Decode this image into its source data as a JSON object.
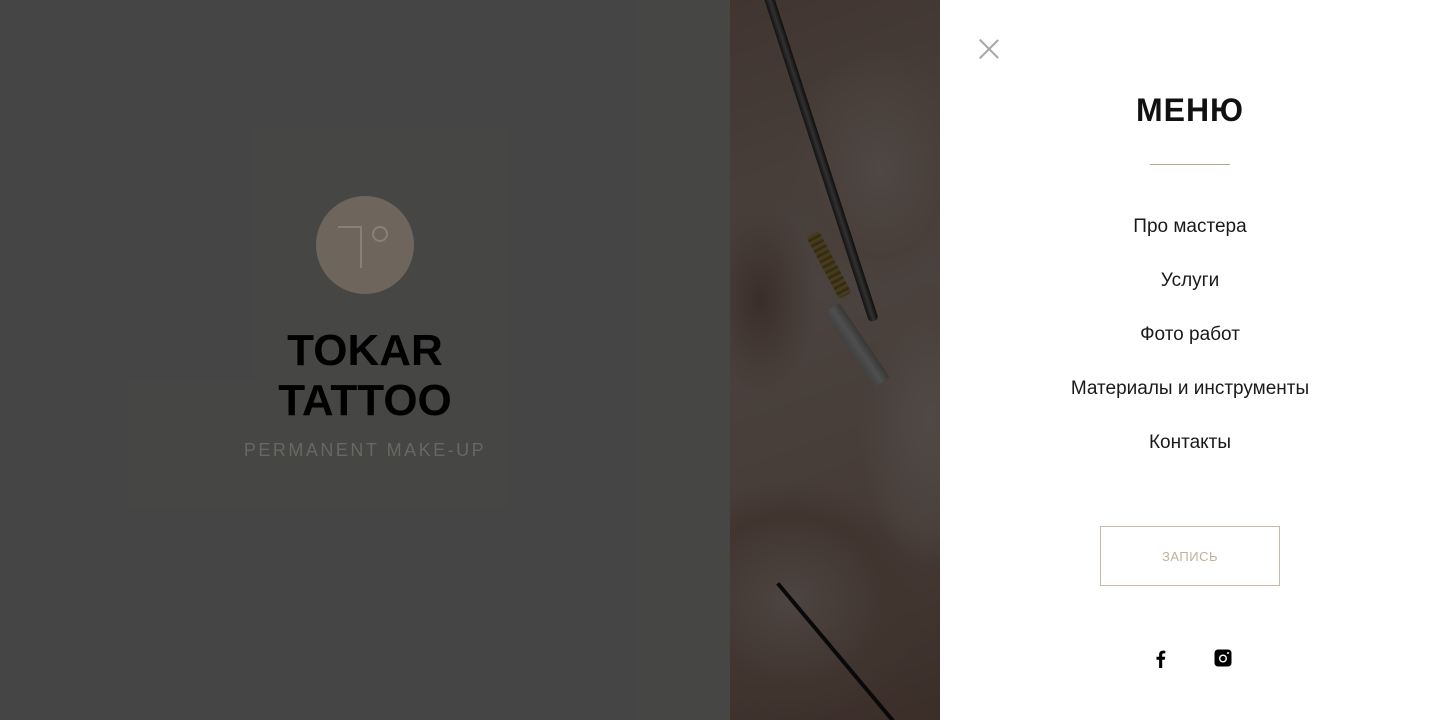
{
  "brand": {
    "title": "TOKAR  TATTOO",
    "subtitle": "PERMANENT MAKE-UP"
  },
  "menu": {
    "title": "МЕНЮ",
    "items": [
      {
        "label": "Про мастера"
      },
      {
        "label": "Услуги"
      },
      {
        "label": "Фото работ"
      },
      {
        "label": "Материалы и инструменты"
      },
      {
        "label": "Контакты"
      }
    ],
    "cta_label": "ЗАПИСЬ"
  },
  "icons": {
    "close": "close-icon",
    "facebook": "facebook-icon",
    "instagram": "instagram-icon"
  },
  "colors": {
    "accent": "#c1b197",
    "overlay": "rgba(0,0,0,0.68)",
    "logo_circle": "#6e665d"
  }
}
